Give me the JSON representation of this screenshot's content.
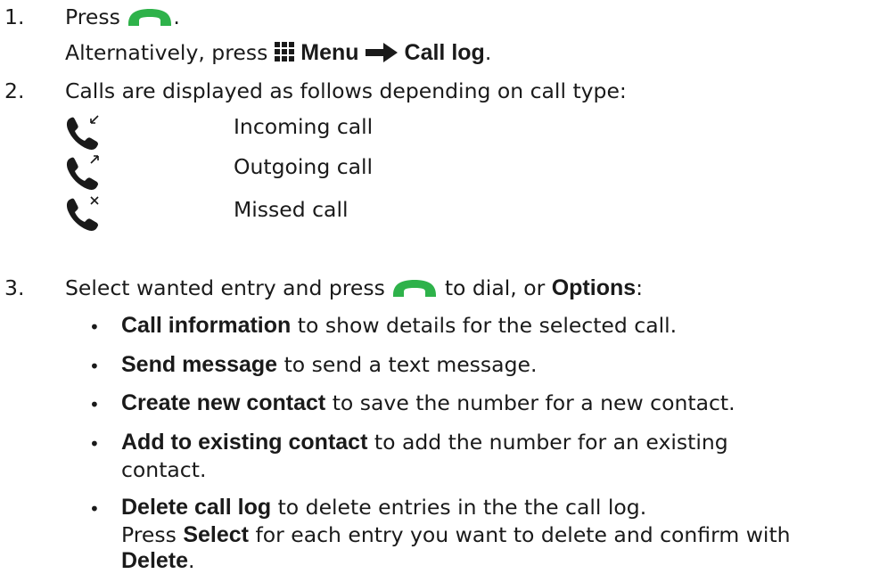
{
  "step1": {
    "num": "1.",
    "press": "Press",
    "period": ".",
    "alt_text": "Alternatively, press",
    "menu": "Menu",
    "call_log": "Call log",
    "alt_period": "."
  },
  "step2": {
    "num": "2.",
    "text": "Calls are displayed as follows depending on call type:",
    "types": [
      {
        "label": "Incoming call",
        "icon": "incoming-call-icon"
      },
      {
        "label": "Outgoing call",
        "icon": "outgoing-call-icon"
      },
      {
        "label": "Missed call",
        "icon": "missed-call-icon"
      }
    ]
  },
  "step3": {
    "num": "3.",
    "pre": "Select wanted entry and press",
    "mid": "to dial, or",
    "options": "Options",
    "colon": ":",
    "bullets": [
      {
        "bold": "Call information",
        "text": " to show details for the selected call."
      },
      {
        "bold": "Send message",
        "text": " to send a text message."
      },
      {
        "bold": "Create new contact",
        "text": " to save the number for a new contact."
      },
      {
        "bold": "Add to existing contact",
        "text": " to add the number for an existing",
        "cont": "contact."
      },
      {
        "bold": "Delete call log",
        "text": " to delete entries in the the call log.",
        "line2_pre": "Press ",
        "line2_bold": "Select",
        "line2_post": " for each entry you want to delete and confirm with",
        "line3_bold": "Delete",
        "line3_post": "."
      }
    ]
  },
  "colors": {
    "call_green": "#2eb24a",
    "text": "#1a1a1a"
  }
}
